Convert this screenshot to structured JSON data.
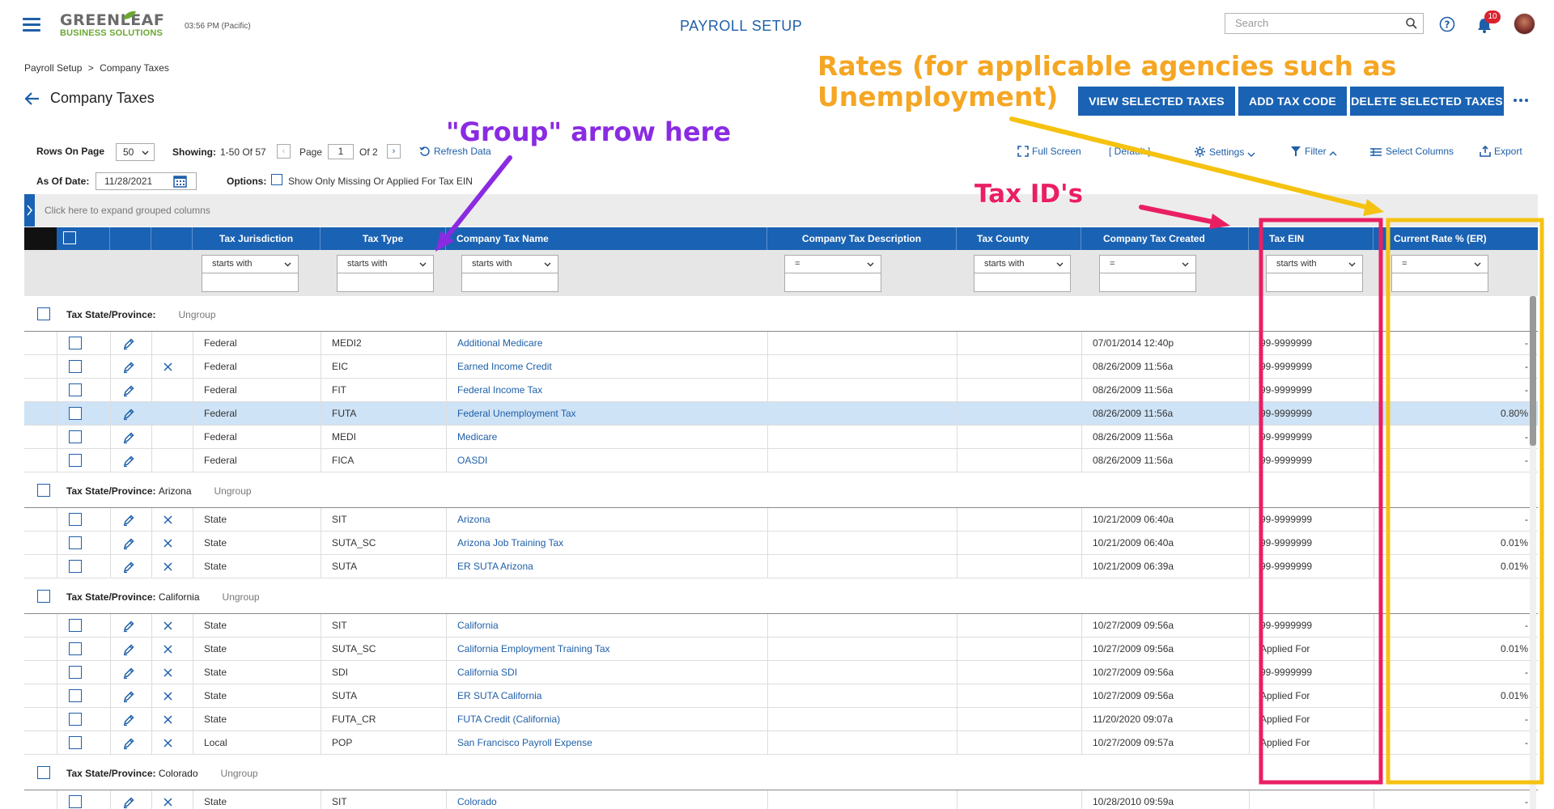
{
  "header": {
    "logo_line1": "GREENLEAF",
    "logo_line2": "BUSINESS SOLUTIONS",
    "time": "03:56 PM (Pacific)",
    "page_heading": "PAYROLL SETUP",
    "search_placeholder": "Search",
    "notification_count": "10",
    "icons": [
      "menu-icon",
      "search-icon",
      "help-icon",
      "bell-icon",
      "avatar"
    ]
  },
  "breadcrumb": {
    "parent": "Payroll Setup",
    "separator": ">",
    "current": "Company Taxes"
  },
  "page_title": "Company Taxes",
  "actions": {
    "view_selected": "VIEW SELECTED TAXES",
    "add_tax_code": "ADD TAX CODE",
    "delete_selected": "DELETE SELECTED TAXES"
  },
  "toolbar": {
    "rows_on_page_label": "Rows On Page",
    "rows_on_page_value": "50",
    "showing_label": "Showing:",
    "showing_value": "1-50 Of 57",
    "page_label": "Page",
    "page_value": "1",
    "page_of": "Of 2",
    "refresh": "Refresh Data",
    "full_screen": "Full Screen",
    "view_default": "[ Default ]",
    "settings": "Settings",
    "filter": "Filter",
    "select_columns": "Select Columns",
    "export": "Export",
    "as_of_date_label": "As Of Date:",
    "as_of_date_value": "11/28/2021",
    "options_label": "Options:",
    "option_missing_ein": "Show Only Missing Or Applied For Tax EIN"
  },
  "group_bar_hint": "Click here to expand grouped columns",
  "columns": [
    "Tax Jurisdiction",
    "Tax Type",
    "Company Tax Name",
    "Company Tax Description",
    "Tax County",
    "Company Tax Created",
    "Tax EIN",
    "Current Rate % (ER)"
  ],
  "filters": [
    "starts with",
    "starts with",
    "starts with",
    "=",
    "starts with",
    "=",
    "starts with",
    "="
  ],
  "group_label": "Tax State/Province:",
  "ungroup_label": "Ungroup",
  "groups": [
    {
      "name": "",
      "rows": [
        {
          "jurisdiction": "Federal",
          "type": "MEDI2",
          "name": "Additional Medicare",
          "created": "07/01/2014 12:40p",
          "ein": "99-9999999",
          "rate": "-",
          "deletable": false,
          "selected": false
        },
        {
          "jurisdiction": "Federal",
          "type": "EIC",
          "name": "Earned Income Credit",
          "created": "08/26/2009 11:56a",
          "ein": "99-9999999",
          "rate": "-",
          "deletable": true,
          "selected": false
        },
        {
          "jurisdiction": "Federal",
          "type": "FIT",
          "name": "Federal Income Tax",
          "created": "08/26/2009 11:56a",
          "ein": "99-9999999",
          "rate": "-",
          "deletable": false,
          "selected": false
        },
        {
          "jurisdiction": "Federal",
          "type": "FUTA",
          "name": "Federal Unemployment Tax",
          "created": "08/26/2009 11:56a",
          "ein": "99-9999999",
          "rate": "0.80%",
          "deletable": false,
          "selected": true
        },
        {
          "jurisdiction": "Federal",
          "type": "MEDI",
          "name": "Medicare",
          "created": "08/26/2009 11:56a",
          "ein": "99-9999999",
          "rate": "-",
          "deletable": false,
          "selected": false
        },
        {
          "jurisdiction": "Federal",
          "type": "FICA",
          "name": "OASDI",
          "created": "08/26/2009 11:56a",
          "ein": "99-9999999",
          "rate": "-",
          "deletable": false,
          "selected": false
        }
      ]
    },
    {
      "name": "Arizona",
      "rows": [
        {
          "jurisdiction": "State",
          "type": "SIT",
          "name": "Arizona",
          "created": "10/21/2009 06:40a",
          "ein": "99-9999999",
          "rate": "-",
          "deletable": true,
          "selected": false
        },
        {
          "jurisdiction": "State",
          "type": "SUTA_SC",
          "name": "Arizona Job Training Tax",
          "created": "10/21/2009 06:40a",
          "ein": "99-9999999",
          "rate": "0.01%",
          "deletable": true,
          "selected": false
        },
        {
          "jurisdiction": "State",
          "type": "SUTA",
          "name": "ER SUTA Arizona",
          "created": "10/21/2009 06:39a",
          "ein": "99-9999999",
          "rate": "0.01%",
          "deletable": true,
          "selected": false
        }
      ]
    },
    {
      "name": "California",
      "rows": [
        {
          "jurisdiction": "State",
          "type": "SIT",
          "name": "California",
          "created": "10/27/2009 09:56a",
          "ein": "99-9999999",
          "rate": "-",
          "deletable": true,
          "selected": false
        },
        {
          "jurisdiction": "State",
          "type": "SUTA_SC",
          "name": "California Employment Training Tax",
          "created": "10/27/2009 09:56a",
          "ein": "Applied For",
          "rate": "0.01%",
          "deletable": true,
          "selected": false
        },
        {
          "jurisdiction": "State",
          "type": "SDI",
          "name": "California SDI",
          "created": "10/27/2009 09:56a",
          "ein": "99-9999999",
          "rate": "-",
          "deletable": true,
          "selected": false
        },
        {
          "jurisdiction": "State",
          "type": "SUTA",
          "name": "ER SUTA California",
          "created": "10/27/2009 09:56a",
          "ein": "Applied For",
          "rate": "0.01%",
          "deletable": true,
          "selected": false
        },
        {
          "jurisdiction": "State",
          "type": "FUTA_CR",
          "name": "FUTA Credit (California)",
          "created": "11/20/2020 09:07a",
          "ein": "Applied For",
          "rate": "-",
          "deletable": true,
          "selected": false
        },
        {
          "jurisdiction": "Local",
          "type": "POP",
          "name": "San Francisco Payroll Expense",
          "created": "10/27/2009 09:57a",
          "ein": "Applied For",
          "rate": "-",
          "deletable": true,
          "selected": false
        }
      ]
    },
    {
      "name": "Colorado",
      "rows": [
        {
          "jurisdiction": "State",
          "type": "SIT",
          "name": "Colorado",
          "created": "10/28/2010 09:59a",
          "ein": "",
          "rate": "-",
          "deletable": true,
          "selected": false
        }
      ]
    }
  ],
  "annotations": {
    "group_arrow": "\"Group\" arrow here",
    "rates_line1": "Rates (for applicable agencies such as",
    "rates_line2": "Unemployment)",
    "tax_ids": "Tax ID's",
    "colors": {
      "purple": "#8a2be2",
      "orange": "#f5a623",
      "pink": "#ea1f63",
      "gold": "#f5c211"
    }
  }
}
